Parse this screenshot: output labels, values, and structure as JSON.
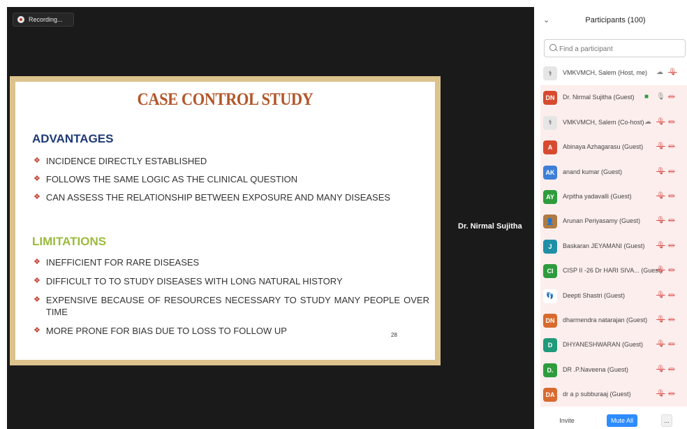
{
  "recording": {
    "label": "Recording..."
  },
  "slide": {
    "title": "CASE CONTROL STUDY",
    "advantages_heading": "ADVANTAGES",
    "advantages": [
      "INCIDENCE DIRECTLY ESTABLISHED",
      "FOLLOWS THE SAME LOGIC AS THE CLINICAL QUESTION",
      "CAN ASSESS THE RELATIONSHIP BETWEEN EXPOSURE AND MANY DISEASES"
    ],
    "limitations_heading": "LIMITATIONS",
    "limitations": [
      "INEFFICIENT FOR RARE DISEASES",
      "DIFFICULT TO TO STUDY DISEASES WITH LONG NATURAL HISTORY",
      "EXPENSIVE BECAUSE OF RESOURCES NECESSARY TO STUDY MANY PEOPLE OVER TIME",
      "MORE PRONE FOR BIAS DUE TO LOSS TO FOLLOW UP"
    ],
    "page_number": "28",
    "bullet_glyph": "❖"
  },
  "speaker": {
    "name": "Dr. Nirmal Sujitha"
  },
  "panel": {
    "title": "Participants (100)",
    "search_placeholder": "Find a participant",
    "participants": [
      {
        "initials": "",
        "avatar": "logo",
        "color": "#e6e6e6",
        "name": "VMKVMCH, Salem (Host, me)",
        "icons": [
          "cloud",
          "mic-off"
        ]
      },
      {
        "initials": "DN",
        "color": "#d84a2f",
        "name": "Dr. Nirmal Sujitha (Guest)",
        "icons": [
          "share",
          "mic",
          "cam-off"
        ]
      },
      {
        "initials": "",
        "avatar": "logo",
        "color": "#e6e6e6",
        "name": "VMKVMCH, Salem (Co-host)",
        "icons": [
          "cloud",
          "mic-off",
          "cam-off"
        ]
      },
      {
        "initials": "A",
        "color": "#d84a2f",
        "name": "Abinaya Azhagarasu (Guest)",
        "icons": [
          "mic-off",
          "cam-off"
        ]
      },
      {
        "initials": "AK",
        "color": "#3d7fd6",
        "name": "anand kumar (Guest)",
        "icons": [
          "mic-off",
          "cam-off"
        ]
      },
      {
        "initials": "AY",
        "color": "#2e9c3d",
        "name": "Arpitha yadavalli (Guest)",
        "icons": [
          "mic-off",
          "cam-off"
        ]
      },
      {
        "initials": "",
        "avatar": "photo",
        "color": "#b07a44",
        "name": "Arunan Periyasamy (Guest)",
        "icons": [
          "mic-off",
          "cam-off"
        ]
      },
      {
        "initials": "J",
        "color": "#1f8fa6",
        "name": "Baskaran JEYAMANI (Guest)",
        "icons": [
          "mic-off",
          "cam-off"
        ]
      },
      {
        "initials": "CI",
        "color": "#2e9c3d",
        "name": "CISP II -26 Dr HARI SIVA... (Guest)",
        "icons": [
          "mic-off",
          "cam-off"
        ]
      },
      {
        "initials": "",
        "avatar": "footprint",
        "color": "#ffffff",
        "name": "Deepti Shastri (Guest)",
        "icons": [
          "mic-off",
          "cam-off"
        ]
      },
      {
        "initials": "DN",
        "color": "#d86a2f",
        "name": "dharmendra natarajan (Guest)",
        "icons": [
          "mic-off",
          "cam-off"
        ]
      },
      {
        "initials": "D",
        "color": "#1f9a7a",
        "name": "DHYANESHWARAN (Guest)",
        "icons": [
          "mic-off",
          "cam-off"
        ]
      },
      {
        "initials": "D.",
        "color": "#2e9c3d",
        "name": "DR .P.Naveena (Guest)",
        "icons": [
          "mic-off",
          "cam-off"
        ]
      },
      {
        "initials": "DA",
        "color": "#d86a2f",
        "name": "dr a p subburaaj (Guest)",
        "icons": [
          "mic-off",
          "cam-off"
        ]
      }
    ],
    "footer": {
      "invite": "Invite",
      "mute_all": "Mute All",
      "more": "..."
    }
  }
}
